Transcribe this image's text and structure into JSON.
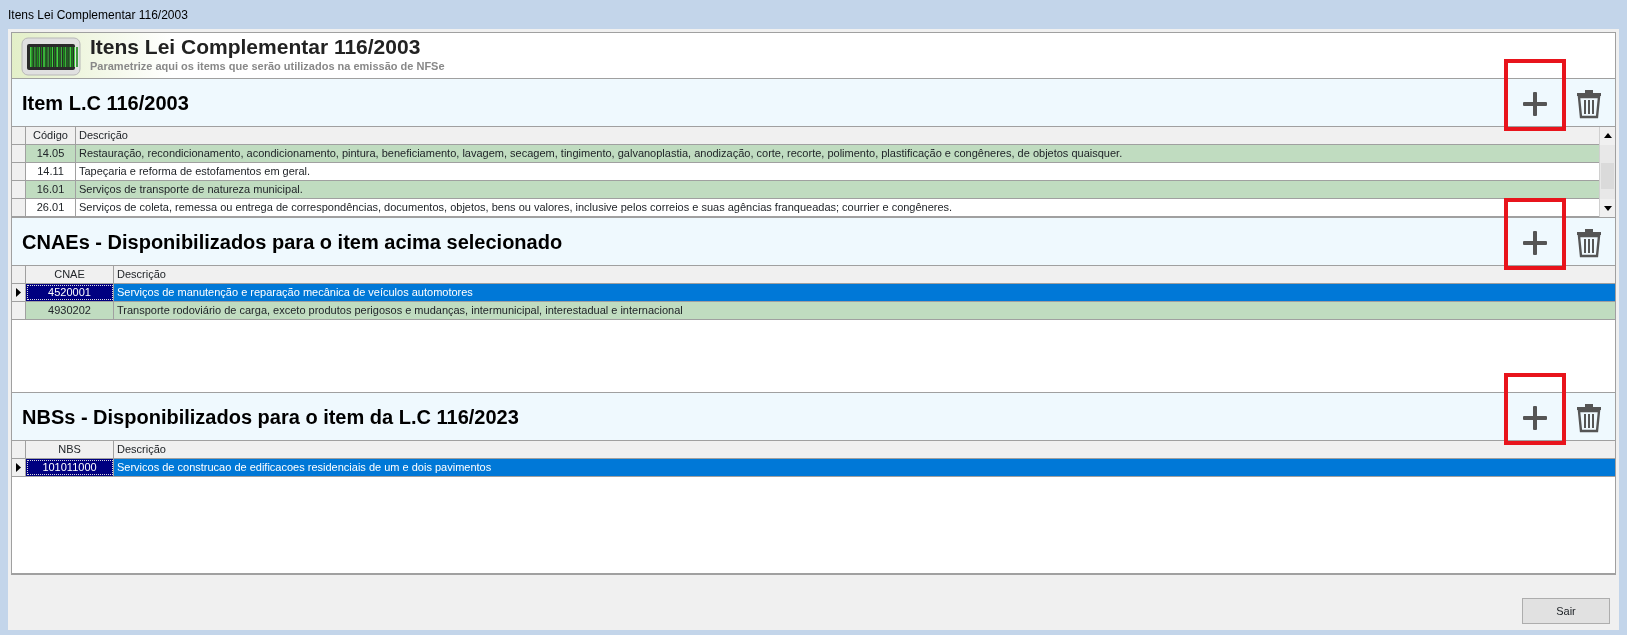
{
  "window": {
    "title": "Itens Lei Complementar 116/2003"
  },
  "header": {
    "title": "Itens Lei Complementar 116/2003",
    "subtitle": "Parametrize aqui os items que serão utilizados na emissão de NFSe"
  },
  "sections": [
    {
      "title": "Item L.C 116/2003",
      "add_highlighted": true,
      "scrollable": true,
      "columns": [
        "Código",
        "Descrição"
      ],
      "rows": [
        {
          "cells": [
            "14.05",
            "Restauração, recondicionamento, acondicionamento, pintura, beneficiamento, lavagem, secagem, tingimento, galvanoplastia, anodização, corte, recorte, polimento, plastificação e congêneres, de objetos quaisquer."
          ],
          "selected": false,
          "shaded": true
        },
        {
          "cells": [
            "14.11",
            "Tapeçaria e reforma de estofamentos em geral."
          ],
          "selected": false,
          "shaded": false
        },
        {
          "cells": [
            "16.01",
            "Serviços de transporte de natureza municipal."
          ],
          "selected": false,
          "shaded": true
        },
        {
          "cells": [
            "26.01",
            "Serviços de coleta, remessa ou entrega de correspondências, documentos, objetos, bens ou valores, inclusive pelos correios e suas agências franqueadas; courrier e congêneres."
          ],
          "selected": false,
          "shaded": false
        }
      ]
    },
    {
      "title": "CNAEs - Disponibilizados para o item acima selecionado",
      "add_highlighted": true,
      "scrollable": false,
      "columns": [
        "CNAE",
        "Descrição"
      ],
      "rows": [
        {
          "cells": [
            "4520001",
            "Serviços de manutenção e reparação mecânica de veículos automotores"
          ],
          "selected": true
        },
        {
          "cells": [
            "4930202",
            "Transporte rodoviário de carga, exceto produtos perigosos e mudanças, intermunicipal, interestadual e internacional"
          ],
          "selected": false,
          "shaded": true
        }
      ]
    },
    {
      "title": "NBSs - Disponibilizados para o item da L.C 116/2023",
      "add_highlighted": true,
      "scrollable": false,
      "columns": [
        "NBS",
        "Descrição"
      ],
      "rows": [
        {
          "cells": [
            "101011000",
            "Servicos de construcao de edificacoes residenciais de um e dois pavimentos"
          ],
          "selected": true
        }
      ]
    }
  ],
  "footer": {
    "buttons": [
      "Sair"
    ]
  }
}
